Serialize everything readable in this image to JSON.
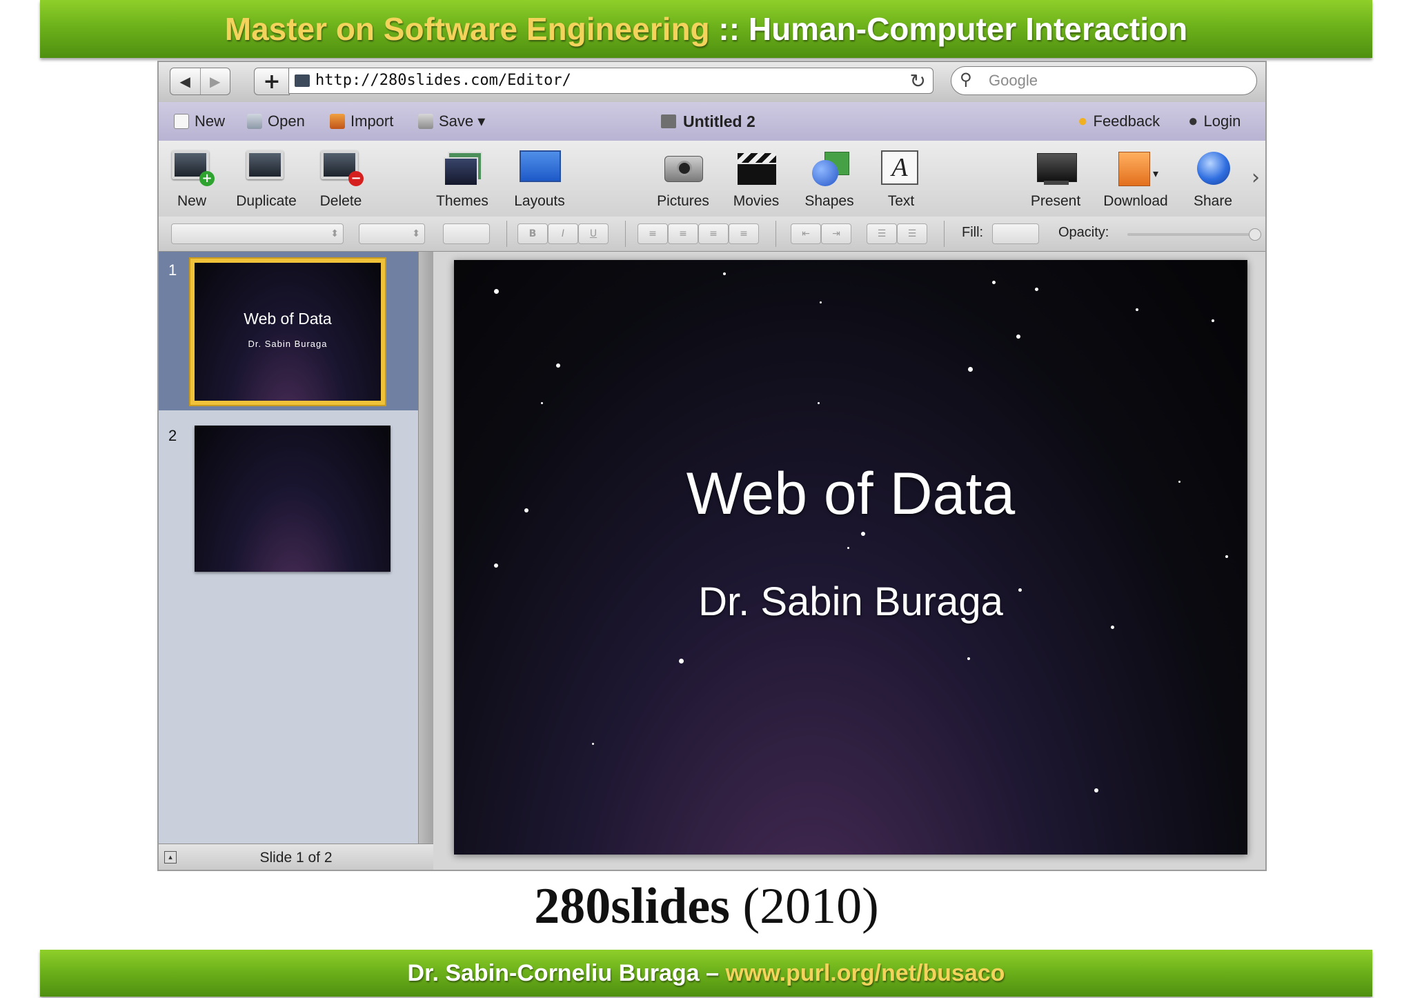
{
  "header": {
    "course": "Master on Software Engineering",
    "separator": " :: ",
    "topic": "Human-Computer Interaction"
  },
  "browser": {
    "back_icon": "back-arrow-icon",
    "forward_icon": "forward-arrow-icon",
    "add_label": "+",
    "url": "http://280slides.com/Editor/",
    "reload_icon": "reload-icon",
    "search_placeholder": "Google"
  },
  "menubar": {
    "new_label": "New",
    "open_label": "Open",
    "import_label": "Import",
    "save_label": "Save ▾",
    "document_title": "Untitled 2",
    "feedback_label": "Feedback",
    "login_label": "Login"
  },
  "toolbar": {
    "new": "New",
    "duplicate": "Duplicate",
    "delete": "Delete",
    "themes": "Themes",
    "layouts": "Layouts",
    "pictures": "Pictures",
    "movies": "Movies",
    "shapes": "Shapes",
    "text": "Text",
    "text_glyph": "A",
    "present": "Present",
    "download": "Download",
    "share": "Share"
  },
  "formatbar": {
    "bold": "B",
    "italic": "I",
    "underline": "U",
    "fill_label": "Fill:",
    "opacity_label": "Opacity:",
    "opacity_value": 1.0
  },
  "slides": [
    {
      "number": "1",
      "title": "Web of Data",
      "subtitle": "Dr. Sabin Buraga",
      "selected": true
    },
    {
      "number": "2",
      "title": "",
      "subtitle": "",
      "selected": false
    }
  ],
  "status": {
    "text": "Slide 1 of 2"
  },
  "current_slide": {
    "title": "Web of Data",
    "subtitle": "Dr. Sabin Buraga"
  },
  "caption": {
    "name": "280slides",
    "year": "(2010)"
  },
  "footer": {
    "author": "Dr. Sabin-Corneliu Buraga",
    "dash": " – ",
    "url": "www.purl.org/net/busaco"
  },
  "colors": {
    "banner_green": "#6db21b",
    "banner_yellow": "#f3d35c",
    "selection_gold": "#f0c23a",
    "menubar_lavender": "#c4bfdc",
    "selected_row": "#7080a2"
  }
}
